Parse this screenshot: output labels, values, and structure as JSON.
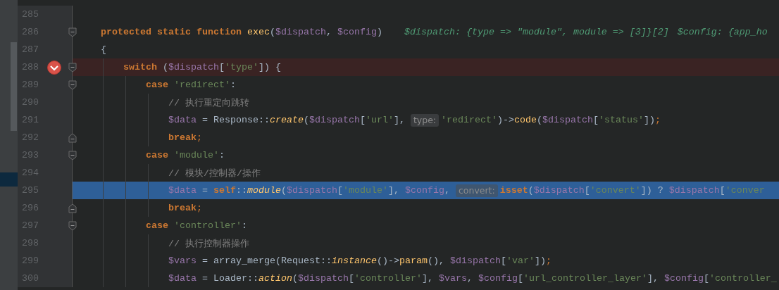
{
  "lines": [
    {
      "number": "285",
      "fold_start": false,
      "fold_end": false,
      "breakpoint": false,
      "selected": false
    },
    {
      "number": "286",
      "fold_start": true,
      "fold_end": false,
      "breakpoint": false,
      "selected": false,
      "tokens": [
        {
          "kind": "kw",
          "text": "    protected static function "
        },
        {
          "kind": "fn",
          "text": "exec"
        },
        {
          "kind": "plain",
          "text": "("
        },
        {
          "kind": "var",
          "text": "$dispatch"
        },
        {
          "kind": "plain",
          "text": ", "
        },
        {
          "kind": "var",
          "text": "$config"
        },
        {
          "kind": "plain",
          "text": ")"
        },
        {
          "kind": "debug",
          "text": "$dispatch: {type => \"module\", module => [3]}[2]"
        },
        {
          "kind": "debug",
          "text": "$config: {app_ho"
        }
      ]
    },
    {
      "number": "287",
      "fold_start": false,
      "fold_end": false,
      "breakpoint": false,
      "selected": false,
      "tokens": [
        {
          "kind": "plain",
          "text": "    {"
        }
      ]
    },
    {
      "number": "288",
      "fold_start": true,
      "fold_end": false,
      "breakpoint": true,
      "selected": false,
      "tokens": [
        {
          "kind": "kw",
          "text": "        switch"
        },
        {
          "kind": "plain",
          "text": " ("
        },
        {
          "kind": "var",
          "text": "$dispatch"
        },
        {
          "kind": "plain",
          "text": "["
        },
        {
          "kind": "str",
          "text": "'type'"
        },
        {
          "kind": "plain",
          "text": "]) {"
        }
      ]
    },
    {
      "number": "289",
      "fold_start": true,
      "fold_end": false,
      "breakpoint": false,
      "selected": false,
      "tokens": [
        {
          "kind": "kw",
          "text": "            case "
        },
        {
          "kind": "str",
          "text": "'redirect'"
        },
        {
          "kind": "plain",
          "text": ":"
        }
      ]
    },
    {
      "number": "290",
      "fold_start": false,
      "fold_end": false,
      "breakpoint": false,
      "selected": false,
      "tokens": [
        {
          "kind": "comment",
          "text": "                // 执行重定向跳转"
        }
      ]
    },
    {
      "number": "291",
      "fold_start": false,
      "fold_end": false,
      "breakpoint": false,
      "selected": false,
      "tokens": [
        {
          "kind": "var",
          "text": "                $data"
        },
        {
          "kind": "plain",
          "text": " = Response::"
        },
        {
          "kind": "fn-static",
          "text": "create"
        },
        {
          "kind": "plain",
          "text": "("
        },
        {
          "kind": "var",
          "text": "$dispatch"
        },
        {
          "kind": "plain",
          "text": "["
        },
        {
          "kind": "str",
          "text": "'url'"
        },
        {
          "kind": "plain",
          "text": "], "
        },
        {
          "kind": "param-hint",
          "text": "type:"
        },
        {
          "kind": "str",
          "text": "'redirect'"
        },
        {
          "kind": "plain",
          "text": ")->"
        },
        {
          "kind": "fn",
          "text": "code"
        },
        {
          "kind": "plain",
          "text": "("
        },
        {
          "kind": "var",
          "text": "$dispatch"
        },
        {
          "kind": "plain",
          "text": "["
        },
        {
          "kind": "str",
          "text": "'status'"
        },
        {
          "kind": "plain",
          "text": "])"
        },
        {
          "kind": "semi",
          "text": ";"
        }
      ]
    },
    {
      "number": "292",
      "fold_start": false,
      "fold_end": true,
      "breakpoint": false,
      "selected": false,
      "tokens": [
        {
          "kind": "kw",
          "text": "                break"
        },
        {
          "kind": "semi",
          "text": ";"
        }
      ]
    },
    {
      "number": "293",
      "fold_start": true,
      "fold_end": false,
      "breakpoint": false,
      "selected": false,
      "tokens": [
        {
          "kind": "kw",
          "text": "            case "
        },
        {
          "kind": "str",
          "text": "'module'"
        },
        {
          "kind": "plain",
          "text": ":"
        }
      ]
    },
    {
      "number": "294",
      "fold_start": false,
      "fold_end": false,
      "breakpoint": false,
      "selected": false,
      "tokens": [
        {
          "kind": "comment",
          "text": "                // 模块/控制器/操作"
        }
      ]
    },
    {
      "number": "295",
      "fold_start": false,
      "fold_end": false,
      "breakpoint": false,
      "selected": true,
      "tokens": [
        {
          "kind": "var",
          "text": "                $data"
        },
        {
          "kind": "plain",
          "text": " = "
        },
        {
          "kind": "kw",
          "text": "self"
        },
        {
          "kind": "plain",
          "text": "::"
        },
        {
          "kind": "fn-static",
          "text": "module"
        },
        {
          "kind": "plain",
          "text": "("
        },
        {
          "kind": "var",
          "text": "$dispatch"
        },
        {
          "kind": "plain",
          "text": "["
        },
        {
          "kind": "str",
          "text": "'module'"
        },
        {
          "kind": "plain",
          "text": "], "
        },
        {
          "kind": "var",
          "text": "$config"
        },
        {
          "kind": "plain",
          "text": ", "
        },
        {
          "kind": "param-hint",
          "text": "convert:"
        },
        {
          "kind": "kw",
          "text": "isset"
        },
        {
          "kind": "plain",
          "text": "("
        },
        {
          "kind": "var",
          "text": "$dispatch"
        },
        {
          "kind": "plain",
          "text": "["
        },
        {
          "kind": "str",
          "text": "'convert'"
        },
        {
          "kind": "plain",
          "text": "]) ? "
        },
        {
          "kind": "var",
          "text": "$dispatch"
        },
        {
          "kind": "plain",
          "text": "["
        },
        {
          "kind": "str",
          "text": "'conver"
        }
      ]
    },
    {
      "number": "296",
      "fold_start": false,
      "fold_end": true,
      "breakpoint": false,
      "selected": false,
      "tokens": [
        {
          "kind": "kw",
          "text": "                break"
        },
        {
          "kind": "semi",
          "text": ";"
        }
      ]
    },
    {
      "number": "297",
      "fold_start": true,
      "fold_end": false,
      "breakpoint": false,
      "selected": false,
      "tokens": [
        {
          "kind": "kw",
          "text": "            case "
        },
        {
          "kind": "str",
          "text": "'controller'"
        },
        {
          "kind": "plain",
          "text": ":"
        }
      ]
    },
    {
      "number": "298",
      "fold_start": false,
      "fold_end": false,
      "breakpoint": false,
      "selected": false,
      "tokens": [
        {
          "kind": "comment",
          "text": "                // 执行控制器操作"
        }
      ]
    },
    {
      "number": "299",
      "fold_start": false,
      "fold_end": false,
      "breakpoint": false,
      "selected": false,
      "tokens": [
        {
          "kind": "var",
          "text": "                $vars"
        },
        {
          "kind": "plain",
          "text": " = array_merge(Request::"
        },
        {
          "kind": "fn-static",
          "text": "instance"
        },
        {
          "kind": "plain",
          "text": "()->"
        },
        {
          "kind": "fn",
          "text": "param"
        },
        {
          "kind": "plain",
          "text": "(), "
        },
        {
          "kind": "var",
          "text": "$dispatch"
        },
        {
          "kind": "plain",
          "text": "["
        },
        {
          "kind": "str",
          "text": "'var'"
        },
        {
          "kind": "plain",
          "text": "])"
        },
        {
          "kind": "semi",
          "text": ";"
        }
      ]
    },
    {
      "number": "300",
      "fold_start": false,
      "fold_end": false,
      "breakpoint": false,
      "selected": false,
      "tokens": [
        {
          "kind": "var",
          "text": "                $data"
        },
        {
          "kind": "plain",
          "text": " = Loader::"
        },
        {
          "kind": "fn-static",
          "text": "action"
        },
        {
          "kind": "plain",
          "text": "("
        },
        {
          "kind": "var",
          "text": "$dispatch"
        },
        {
          "kind": "plain",
          "text": "["
        },
        {
          "kind": "str",
          "text": "'controller'"
        },
        {
          "kind": "plain",
          "text": "], "
        },
        {
          "kind": "var",
          "text": "$vars"
        },
        {
          "kind": "plain",
          "text": ", "
        },
        {
          "kind": "var",
          "text": "$config"
        },
        {
          "kind": "plain",
          "text": "["
        },
        {
          "kind": "str",
          "text": "'url_controller_layer'"
        },
        {
          "kind": "plain",
          "text": "], "
        },
        {
          "kind": "var",
          "text": "$config"
        },
        {
          "kind": "plain",
          "text": "["
        },
        {
          "kind": "str",
          "text": "'controller_"
        }
      ]
    }
  ]
}
